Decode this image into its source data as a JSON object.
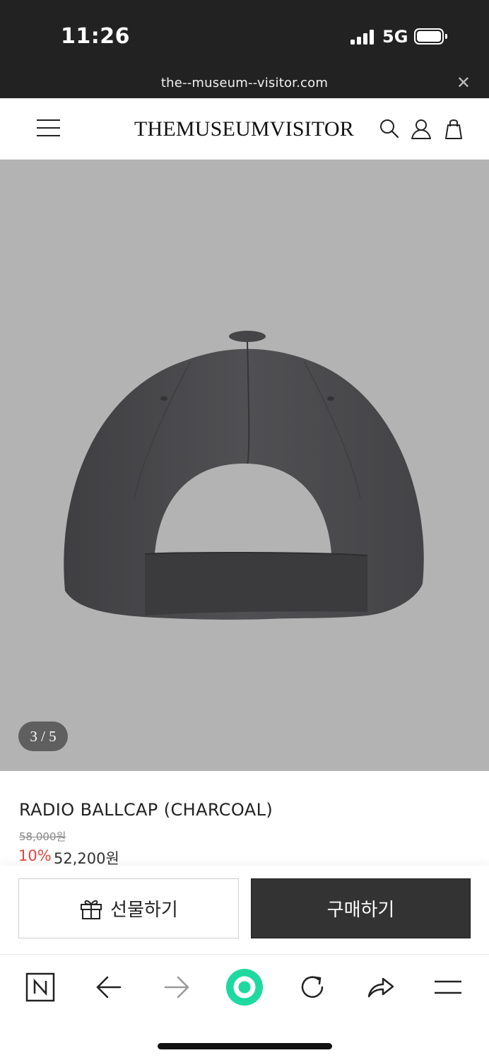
{
  "status_bar": {
    "time": "11:26",
    "network": "5G"
  },
  "browser": {
    "url": "the--museum--visitor.com",
    "close_label": "✕"
  },
  "header": {
    "logo": "THEMUSEUMVISITOR"
  },
  "gallery": {
    "counter": "3 / 5",
    "current": 3,
    "total": 5
  },
  "product": {
    "title": "RADIO BALLCAP (CHARCOAL)",
    "original_price": "58,000원",
    "discount": "10%",
    "sale_price": "52,200원"
  },
  "actions": {
    "gift_label": "선물하기",
    "buy_label": "구매하기"
  },
  "colors": {
    "status_bg": "#222222",
    "image_bg": "#b3b3b3",
    "buy_bg": "#333333",
    "discount": "#e0453f",
    "accent_green": "#1ed9a0"
  },
  "icons": {
    "header": [
      "menu-icon",
      "search-icon",
      "user-icon",
      "shopping-bag-icon"
    ],
    "browser_bar": [
      "naver-n-icon",
      "back-arrow-icon",
      "forward-arrow-icon",
      "green-dot-icon",
      "reload-icon",
      "share-icon",
      "menu-icon"
    ]
  }
}
